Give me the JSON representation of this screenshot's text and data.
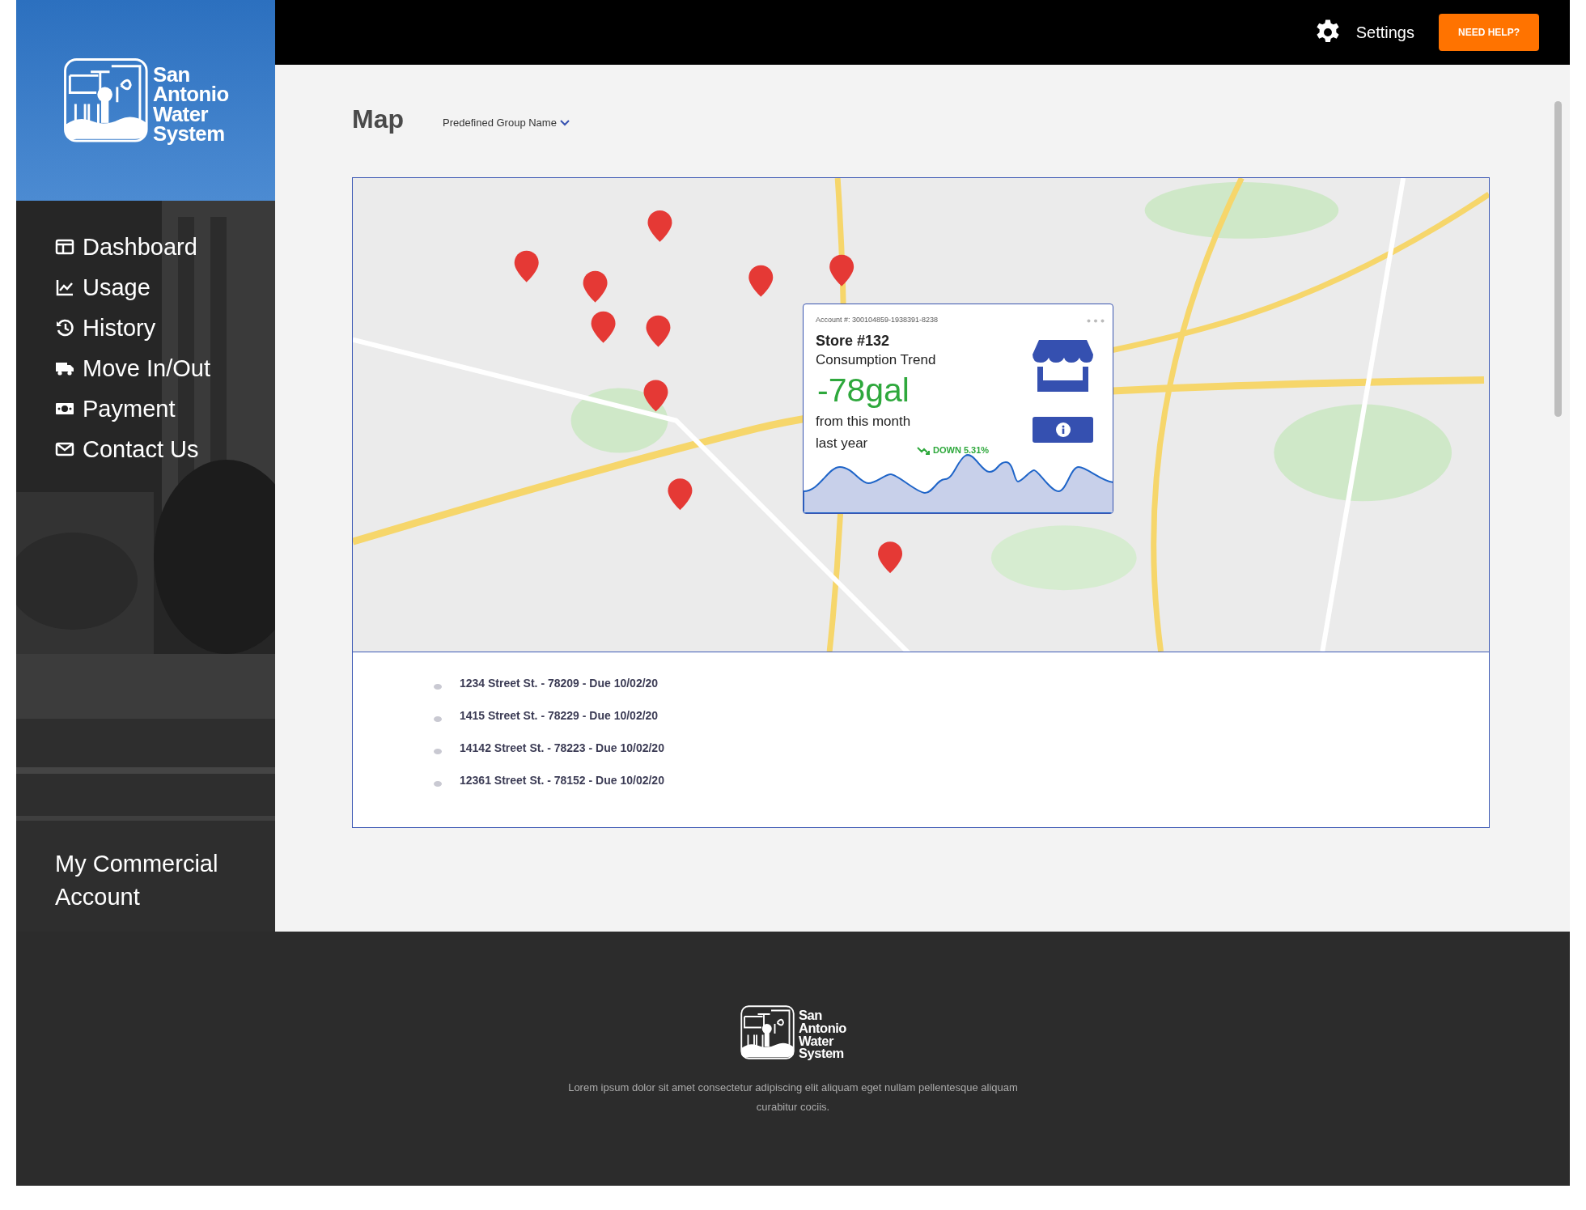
{
  "sidebar": {
    "logo": {
      "lines": [
        "San",
        "Antonio",
        "Water",
        "System"
      ]
    },
    "items": [
      {
        "label": "Dashboard"
      },
      {
        "label": "Usage"
      },
      {
        "label": "History"
      },
      {
        "label": "Move In/Out"
      },
      {
        "label": "Payment"
      },
      {
        "label": "Contact Us"
      }
    ],
    "account": "My Commercial Account"
  },
  "topbar": {
    "settings": "Settings",
    "help_button": "NEED HELP?"
  },
  "page": {
    "title": "Map",
    "group_select": "Predefined Group Name"
  },
  "map": {
    "kind": "picture",
    "popup": {
      "account_label": "Account #:",
      "account_number": "300104859-1938391-8238",
      "store": "Store #132",
      "subtitle": "Consumption Trend",
      "value": "-78gal",
      "caption_lines": [
        "from this month",
        "last year"
      ],
      "trend": "DOWN 5.31%"
    }
  },
  "addresses": [
    "1234 Street St. - 78209 - Due 10/02/20",
    "1415 Street St. - 78229 - Due 10/02/20",
    "14142 Street St. - 78223 - Due 10/02/20",
    "12361 Street St. - 78152 - Due 10/02/20"
  ],
  "footer": {
    "logo": {
      "lines": [
        "San",
        "Antonio",
        "Water",
        "System"
      ]
    },
    "text": "Lorem ipsum dolor sit amet consectetur adipiscing elit aliquam eget nullam pellentesque aliquam curabitur cociis."
  }
}
